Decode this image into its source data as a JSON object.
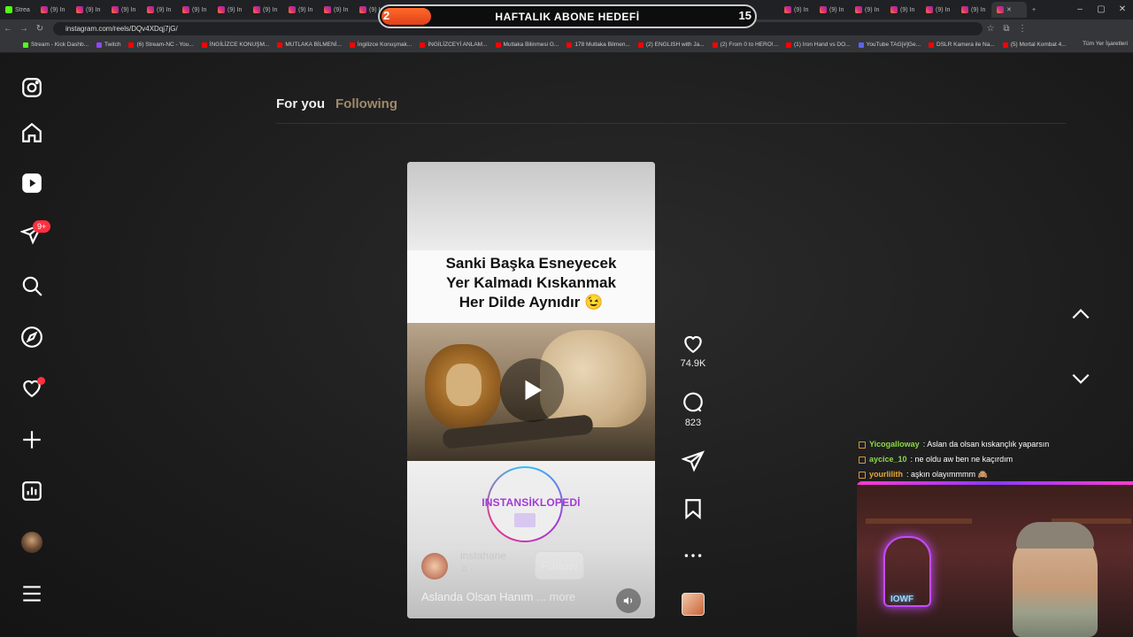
{
  "browser": {
    "url": "instagram.com/reels/DQv4XDqj7jG/",
    "tab_label": "(9) In",
    "kick_tab_label": "Strea",
    "bookmarks": [
      "Stream - Kick Dashb...",
      "Twitch",
      "(6) Stream-NC - You...",
      "İNGİLİZCE KONUŞM...",
      "MUTLAKA BİLMENİ...",
      "İngilizce Konuşmak...",
      "İNGİLİZCEYİ ANLAM...",
      "Mutlaka Bilinmesi G...",
      "178 Mutlaka Bilmen...",
      "(2) ENGLISH with Ja...",
      "(2) From 0 to HERO!...",
      "(1) Iron Hand vs DO...",
      "YouTube TAG[#]Ge...",
      "DSLR Kamera ile Na...",
      "(5) Mortal Kombat 4..."
    ],
    "bookmarks_right": "Tüm Yer İşaretleri"
  },
  "overlay_goal": {
    "current": "2",
    "label": "HAFTALIK ABONE HEDEFİ",
    "target": "15",
    "progress_fraction": 0.13
  },
  "sidebar": {
    "notification_badge": "9+"
  },
  "feed": {
    "tab_foryou": "For you",
    "tab_following": "Following"
  },
  "reel": {
    "caption_line1": "Sanki Başka Esneyecek",
    "caption_line2": "Yer Kalmadı Kıskanmak",
    "caption_line3": "Her Dilde Aynıdır 😉",
    "brand": "INSTANSİKLOPEDİ",
    "author": "instahane",
    "music": "♫ ·",
    "follow_label": "Follow",
    "description": "Aslanda Olsan Hanım",
    "more_label": "... more"
  },
  "actions": {
    "likes": "74.9K",
    "comments": "823"
  },
  "chat": [
    {
      "user": "Yicogalloway",
      "message": ": Aslan da olsan kıskançlık yaparsın"
    },
    {
      "user": "aycice_10",
      "message": ": ne oldu aw ben ne kaçırdım"
    },
    {
      "user": "yourlilith",
      "message": ": aşkın olayımmmm 🙈"
    }
  ],
  "webcam": {
    "neon_sign": "IOWF"
  },
  "colors": {
    "accent_red": "#ff3040",
    "brand_purple": "#a23bd6",
    "goal_orange": "#ff6a2a"
  }
}
